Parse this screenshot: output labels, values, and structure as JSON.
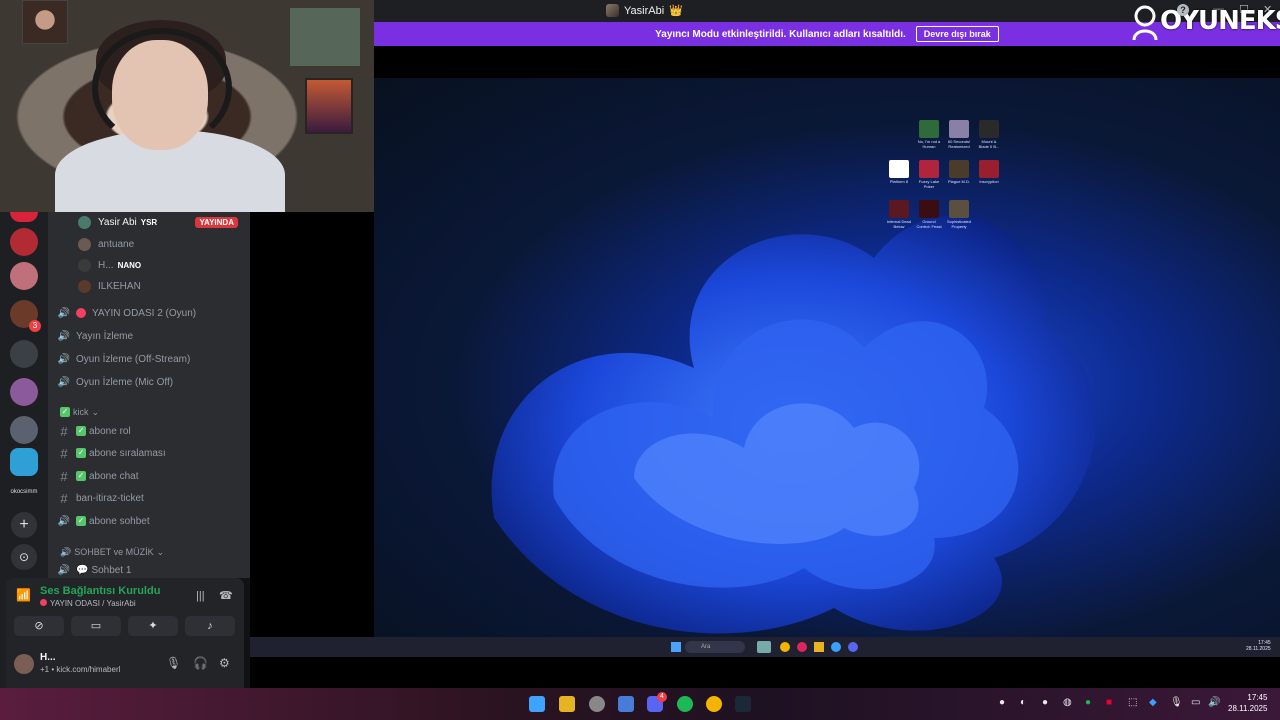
{
  "window": {
    "title": "YasirAbi",
    "title_emoji": "👑",
    "controls": [
      "—",
      "☐",
      "✕"
    ]
  },
  "banner": {
    "message": "Yayıncı Modu etkinleştirildi. Kullanıcı adları kısaltıldı.",
    "button_label": "Devre dışı bırak"
  },
  "logo": {
    "text": "OYUNEKS"
  },
  "sidebar": {
    "server_label": "okocsimm",
    "server_badge": "3",
    "voice_users": [
      {
        "name": "Yasir Abi",
        "tag": "YSR",
        "live": "YAYINDA"
      },
      {
        "name": "antuane"
      },
      {
        "name": "H...",
        "tag": "NANO"
      },
      {
        "name": "ILKEHAN"
      }
    ],
    "voice_channels": [
      "YAYIN ODASI 2 (Oyun)",
      "Yayın İzleme",
      "Oyun İzleme (Off-Stream)",
      "Oyun İzleme (Mic Off)"
    ],
    "category_kick": "kick",
    "text_channels": [
      {
        "name": "abone  rol",
        "checked": true
      },
      {
        "name": "abone  sıralaması",
        "checked": true
      },
      {
        "name": "abone  chat",
        "checked": true
      },
      {
        "name": "ban-itiraz-ticket",
        "checked": false
      },
      {
        "name": "abone sohbet",
        "checked": true,
        "voice": true
      }
    ],
    "category_music": "SOHBET ve MÜZİK",
    "music_channels": [
      "Sohbet 1"
    ]
  },
  "voice_panel": {
    "status": "Ses Bağlantısı Kuruldu",
    "room": "YAYIN ODASI / YasirAbi"
  },
  "user_panel": {
    "name": "H...",
    "subtitle": "+1 • kick.com/himaberl"
  },
  "desktop_icons": [
    "No, I'm not a Human",
    "60 Seconds! Reatomized",
    "Mount & Blade II B...",
    "Platform 8",
    "Fuzzy Lake Poker",
    "Plague M.D.",
    "Inscryption",
    "Infernal Dead Below",
    "Ground Control: Feast",
    "Sophisticated Property"
  ],
  "stream_taskbar": {
    "search_placeholder": "Ara",
    "time": "17:45",
    "date": "28.11.2025"
  },
  "host_taskbar": {
    "time": "17:45",
    "date": "28.11.2025",
    "discord_badge": "4"
  },
  "colors": {
    "accent": "#7b2fe3",
    "live": "#da373c",
    "connected": "#23a55a"
  }
}
